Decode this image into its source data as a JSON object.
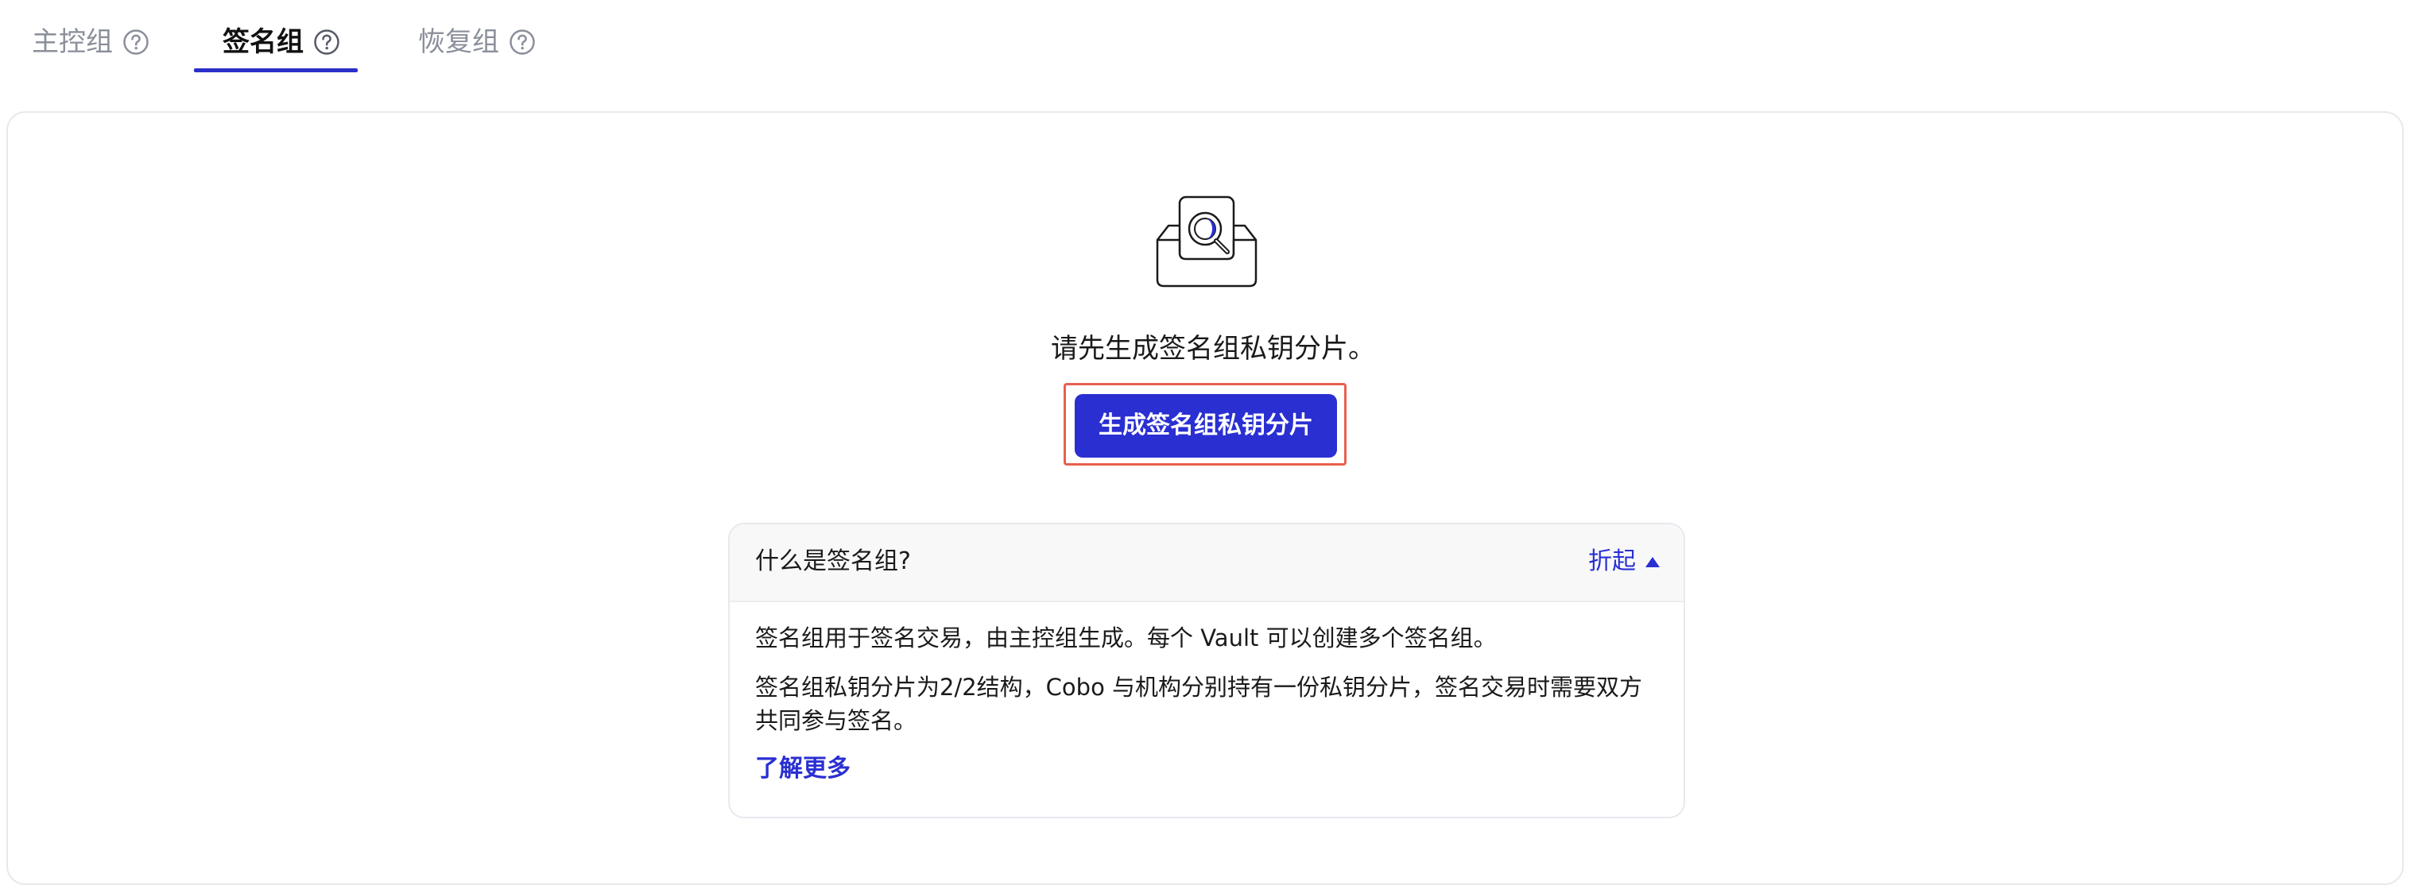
{
  "tabs": [
    {
      "label": "主控组",
      "active": false
    },
    {
      "label": "签名组",
      "active": true
    },
    {
      "label": "恢复组",
      "active": false
    }
  ],
  "empty_state": {
    "illustration": "inbox-search-icon",
    "message": "请先生成签名组私钥分片。",
    "button_label": "生成签名组私钥分片"
  },
  "info_panel": {
    "title": "什么是签名组?",
    "collapse_label": "折起",
    "paragraphs": [
      "签名组用于签名交易，由主控组生成。每个 Vault 可以创建多个签名组。",
      "签名组私钥分片为2/2结构，Cobo 与机构分别持有一份私钥分片，签名交易时需要双方共同参与签名。"
    ],
    "learn_more_label": "了解更多"
  },
  "colors": {
    "accent": "#2a2fd2",
    "highlight_border": "#e8604f",
    "muted_text": "#8a8f9a"
  }
}
